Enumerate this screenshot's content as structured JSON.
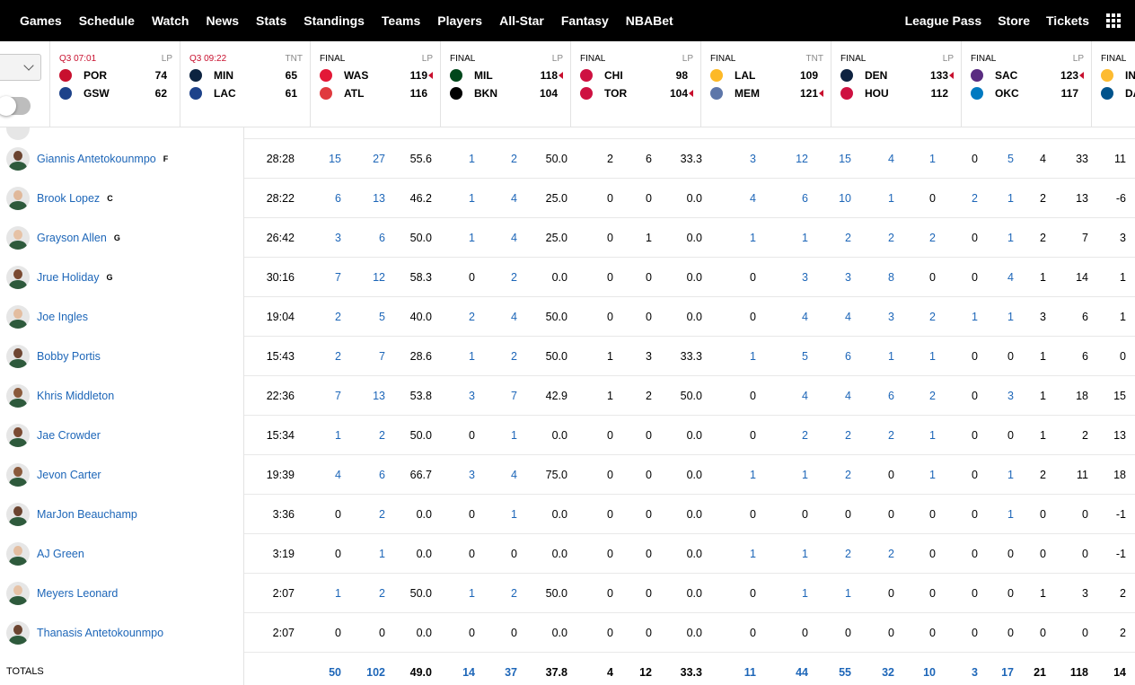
{
  "nav": {
    "left": [
      "Games",
      "Schedule",
      "Watch",
      "News",
      "Stats",
      "Standings",
      "Teams",
      "Players",
      "All-Star",
      "Fantasy",
      "NBABet"
    ],
    "right": [
      "League Pass",
      "Store",
      "Tickets"
    ]
  },
  "games": [
    {
      "status": "Q3 07:01",
      "live": true,
      "net": "LP",
      "teams": [
        {
          "abbr": "POR",
          "score": "74",
          "color": "#c8102e",
          "winner": false
        },
        {
          "abbr": "GSW",
          "score": "62",
          "color": "#1d428a",
          "winner": false
        }
      ]
    },
    {
      "status": "Q3 09:22",
      "live": true,
      "net": "TNT",
      "teams": [
        {
          "abbr": "MIN",
          "score": "65",
          "color": "#0c2340",
          "winner": false
        },
        {
          "abbr": "LAC",
          "score": "61",
          "color": "#1d428a",
          "winner": false
        }
      ]
    },
    {
      "status": "FINAL",
      "live": false,
      "net": "LP",
      "teams": [
        {
          "abbr": "WAS",
          "score": "119",
          "color": "#e31837",
          "winner": true
        },
        {
          "abbr": "ATL",
          "score": "116",
          "color": "#e03a3e",
          "winner": false
        }
      ]
    },
    {
      "status": "FINAL",
      "live": false,
      "net": "LP",
      "teams": [
        {
          "abbr": "MIL",
          "score": "118",
          "color": "#00471b",
          "winner": true
        },
        {
          "abbr": "BKN",
          "score": "104",
          "color": "#000000",
          "winner": false
        }
      ]
    },
    {
      "status": "FINAL",
      "live": false,
      "net": "LP",
      "teams": [
        {
          "abbr": "CHI",
          "score": "98",
          "color": "#ce1141",
          "winner": false
        },
        {
          "abbr": "TOR",
          "score": "104",
          "color": "#ce1141",
          "winner": true
        }
      ]
    },
    {
      "status": "FINAL",
      "live": false,
      "net": "TNT",
      "teams": [
        {
          "abbr": "LAL",
          "score": "109",
          "color": "#fdb927",
          "winner": false
        },
        {
          "abbr": "MEM",
          "score": "121",
          "color": "#5d76a9",
          "winner": true
        }
      ]
    },
    {
      "status": "FINAL",
      "live": false,
      "net": "LP",
      "teams": [
        {
          "abbr": "DEN",
          "score": "133",
          "color": "#0e2240",
          "winner": true
        },
        {
          "abbr": "HOU",
          "score": "112",
          "color": "#ce1141",
          "winner": false
        }
      ]
    },
    {
      "status": "FINAL",
      "live": false,
      "net": "LP",
      "teams": [
        {
          "abbr": "SAC",
          "score": "123",
          "color": "#5a2d81",
          "winner": true
        },
        {
          "abbr": "OKC",
          "score": "117",
          "color": "#007ac1",
          "winner": false
        }
      ]
    },
    {
      "status": "FINAL",
      "live": false,
      "net": "",
      "teams": [
        {
          "abbr": "IN",
          "score": "",
          "color": "#fdbb30",
          "winner": false
        },
        {
          "abbr": "DA",
          "score": "",
          "color": "#00538c",
          "winner": false
        }
      ]
    }
  ],
  "players": [
    {
      "name": "Giannis Antetokounmpo",
      "pos": "F",
      "skin": "#6b4430",
      "stats": [
        "28:28",
        "15",
        "27",
        "55.6",
        "1",
        "2",
        "50.0",
        "2",
        "6",
        "33.3",
        "3",
        "12",
        "15",
        "4",
        "1",
        "0",
        "5",
        "4",
        "33",
        "11"
      ]
    },
    {
      "name": "Brook Lopez",
      "pos": "C",
      "skin": "#e0b89a",
      "stats": [
        "28:22",
        "6",
        "13",
        "46.2",
        "1",
        "4",
        "25.0",
        "0",
        "0",
        "0.0",
        "4",
        "6",
        "10",
        "1",
        "0",
        "2",
        "1",
        "2",
        "13",
        "-6"
      ]
    },
    {
      "name": "Grayson Allen",
      "pos": "G",
      "skin": "#e6c2a6",
      "stats": [
        "26:42",
        "3",
        "6",
        "50.0",
        "1",
        "4",
        "25.0",
        "0",
        "1",
        "0.0",
        "1",
        "1",
        "2",
        "2",
        "2",
        "0",
        "1",
        "2",
        "7",
        "3"
      ]
    },
    {
      "name": "Jrue Holiday",
      "pos": "G",
      "skin": "#7a4a32",
      "stats": [
        "30:16",
        "7",
        "12",
        "58.3",
        "0",
        "2",
        "0.0",
        "0",
        "0",
        "0.0",
        "0",
        "3",
        "3",
        "8",
        "0",
        "0",
        "4",
        "1",
        "14",
        "1"
      ]
    },
    {
      "name": "Joe Ingles",
      "pos": "",
      "skin": "#e3bda0",
      "stats": [
        "19:04",
        "2",
        "5",
        "40.0",
        "2",
        "4",
        "50.0",
        "0",
        "0",
        "0.0",
        "0",
        "4",
        "4",
        "3",
        "2",
        "1",
        "1",
        "3",
        "6",
        "1"
      ]
    },
    {
      "name": "Bobby Portis",
      "pos": "",
      "skin": "#6e4632",
      "stats": [
        "15:43",
        "2",
        "7",
        "28.6",
        "1",
        "2",
        "50.0",
        "1",
        "3",
        "33.3",
        "1",
        "5",
        "6",
        "1",
        "1",
        "0",
        "0",
        "1",
        "6",
        "0"
      ]
    },
    {
      "name": "Khris Middleton",
      "pos": "",
      "skin": "#8a5a3c",
      "stats": [
        "22:36",
        "7",
        "13",
        "53.8",
        "3",
        "7",
        "42.9",
        "1",
        "2",
        "50.0",
        "0",
        "4",
        "4",
        "6",
        "2",
        "0",
        "3",
        "1",
        "18",
        "15"
      ]
    },
    {
      "name": "Jae Crowder",
      "pos": "",
      "skin": "#7a4a32",
      "stats": [
        "15:34",
        "1",
        "2",
        "50.0",
        "0",
        "1",
        "0.0",
        "0",
        "0",
        "0.0",
        "0",
        "2",
        "2",
        "2",
        "1",
        "0",
        "0",
        "1",
        "2",
        "13"
      ]
    },
    {
      "name": "Jevon Carter",
      "pos": "",
      "skin": "#8a5a3c",
      "stats": [
        "19:39",
        "4",
        "6",
        "66.7",
        "3",
        "4",
        "75.0",
        "0",
        "0",
        "0.0",
        "1",
        "1",
        "2",
        "0",
        "1",
        "0",
        "1",
        "2",
        "11",
        "18"
      ]
    },
    {
      "name": "MarJon Beauchamp",
      "pos": "",
      "skin": "#6b4430",
      "stats": [
        "3:36",
        "0",
        "2",
        "0.0",
        "0",
        "1",
        "0.0",
        "0",
        "0",
        "0.0",
        "0",
        "0",
        "0",
        "0",
        "0",
        "0",
        "1",
        "0",
        "0",
        "-1"
      ]
    },
    {
      "name": "AJ Green",
      "pos": "",
      "skin": "#e3bda0",
      "stats": [
        "3:19",
        "0",
        "1",
        "0.0",
        "0",
        "0",
        "0.0",
        "0",
        "0",
        "0.0",
        "1",
        "1",
        "2",
        "2",
        "0",
        "0",
        "0",
        "0",
        "0",
        "-1"
      ]
    },
    {
      "name": "Meyers Leonard",
      "pos": "",
      "skin": "#e6c2a6",
      "stats": [
        "2:07",
        "1",
        "2",
        "50.0",
        "1",
        "2",
        "50.0",
        "0",
        "0",
        "0.0",
        "0",
        "1",
        "1",
        "0",
        "0",
        "0",
        "0",
        "1",
        "3",
        "2"
      ]
    },
    {
      "name": "Thanasis Antetokounmpo",
      "pos": "",
      "skin": "#6b4430",
      "stats": [
        "2:07",
        "0",
        "0",
        "0.0",
        "0",
        "0",
        "0.0",
        "0",
        "0",
        "0.0",
        "0",
        "0",
        "0",
        "0",
        "0",
        "0",
        "0",
        "0",
        "0",
        "2"
      ]
    }
  ],
  "totals": {
    "label": "TOTALS",
    "stats": [
      "",
      "50",
      "102",
      "49.0",
      "14",
      "37",
      "37.8",
      "4",
      "12",
      "33.3",
      "11",
      "44",
      "55",
      "32",
      "10",
      "3",
      "17",
      "21",
      "118",
      "14"
    ]
  }
}
